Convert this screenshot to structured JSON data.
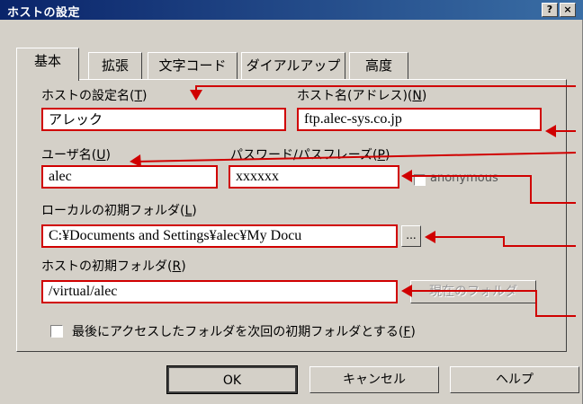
{
  "window": {
    "title": "ホストの設定",
    "help_button": "?",
    "close_button": "×"
  },
  "tabs": [
    {
      "label": "基本",
      "active": true
    },
    {
      "label": "拡張",
      "active": false
    },
    {
      "label": "文字コード",
      "active": false
    },
    {
      "label": "ダイアルアップ",
      "active": false
    },
    {
      "label": "高度",
      "active": false
    }
  ],
  "form": {
    "host_setting_name": {
      "label": "ホストの設定名(",
      "mnemonic": "T",
      "label_end": ")",
      "value": "アレック"
    },
    "host_name": {
      "label": "ホスト名(アドレス)(",
      "mnemonic": "N",
      "label_end": ")",
      "value": "ftp.alec-sys.co.jp"
    },
    "user_name": {
      "label": "ユーザ名(",
      "mnemonic": "U",
      "label_end": ")",
      "value": "alec"
    },
    "password": {
      "label": "パスワード/パスフレーズ(",
      "mnemonic": "P",
      "label_end": ")",
      "value": "xxxxxx"
    },
    "anonymous": {
      "label": "anonymous",
      "checked": false
    },
    "local_folder": {
      "label": "ローカルの初期フォルダ(",
      "mnemonic": "L",
      "label_end": ")",
      "value": "C:¥Documents and Settings¥alec¥My Docu",
      "browse_label": "..."
    },
    "host_folder": {
      "label": "ホストの初期フォルダ(",
      "mnemonic": "R",
      "label_end": ")",
      "value": "/virtual/alec",
      "current_folder_label": "現在のフォルダ"
    },
    "last_access": {
      "label": "最後にアクセスしたフォルダを次回の初期フォルダとする(",
      "mnemonic": "F",
      "label_end": ")",
      "checked": false
    }
  },
  "buttons": {
    "ok": "OK",
    "cancel": "キャンセル",
    "help": "ヘルプ"
  },
  "colors": {
    "titlebar": "#0a246a",
    "annotation": "#d00000",
    "dialog": "#d4d0c8"
  }
}
